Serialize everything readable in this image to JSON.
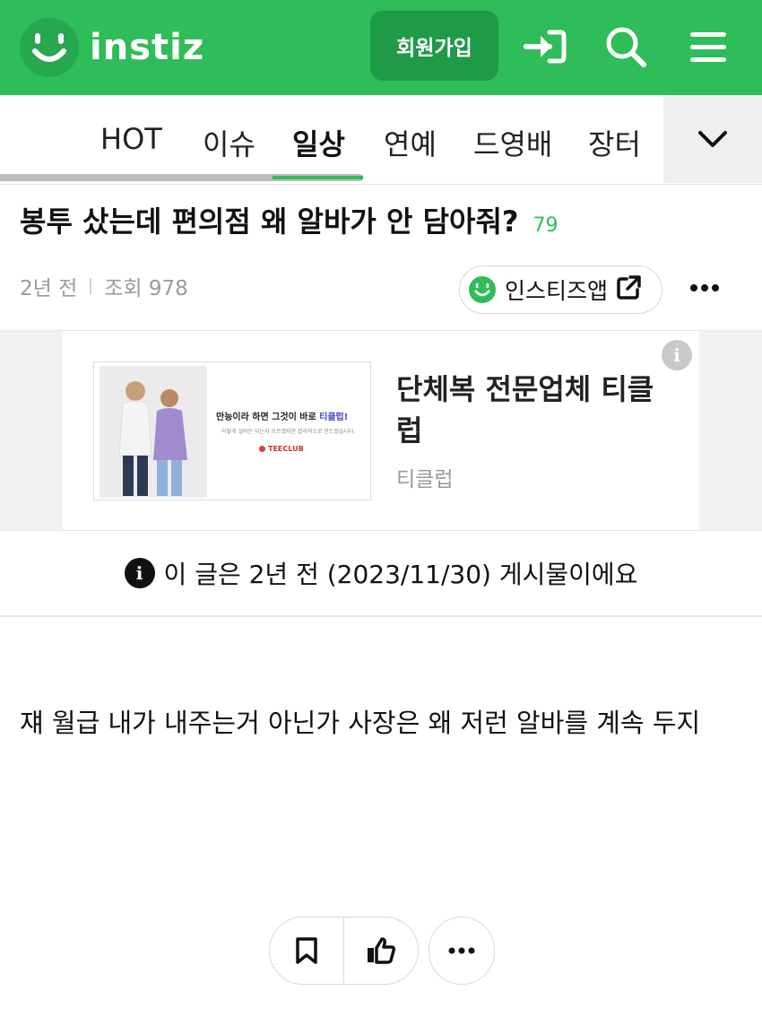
{
  "header": {
    "logo_text": "instiz",
    "signup_label": "회원가입",
    "icons": [
      "smile-logo-icon",
      "login-icon",
      "search-icon",
      "menu-icon"
    ],
    "brand_color": "#2ebd59"
  },
  "tabs": {
    "items": [
      {
        "label": "HOT"
      },
      {
        "label": "이슈"
      },
      {
        "label": "일상"
      },
      {
        "label": "연예"
      },
      {
        "label": "드영배"
      },
      {
        "label": "장터"
      }
    ],
    "active": "일상",
    "more_icon": "chevron-down-icon"
  },
  "post": {
    "title": "봉투 샀는데 편의점 왜 알바가 안 담아줘?",
    "comment_count": "79",
    "time": "2년 전",
    "views": "조회 978",
    "app_label": "인스티즈앱",
    "body": "쟤 월급 내가 내주는거 아닌가 사장은 왜 저런 알바를 계속 두지"
  },
  "ad": {
    "banner_headline_pre": "만능이라 하면 그것이 바로 ",
    "banner_headline_highlight": "티클럽!",
    "banner_small": "어떻게 얼마든 되는지 모르겠지만 합리적으로 만드렸습니다.",
    "banner_brand": "TEECLUB",
    "title": "단체복 전문업체 티클럽",
    "advertiser": "티클럽",
    "info_glyph": "i"
  },
  "notice": {
    "glyph": "i",
    "text": "이 글은 2년 전 (2023/11/30) 게시물이에요"
  }
}
